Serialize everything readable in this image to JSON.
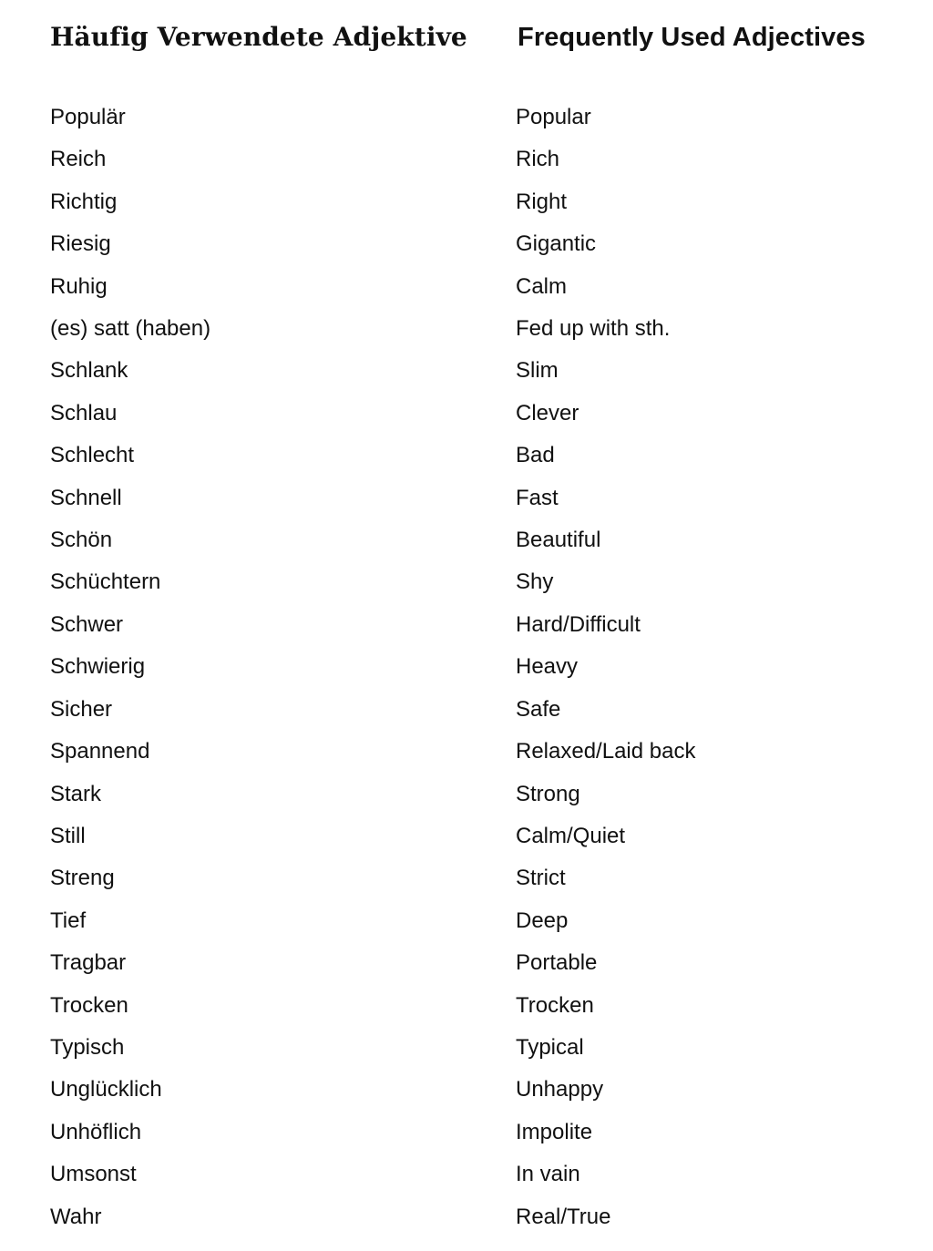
{
  "document": {
    "title": "Häufig Verwendete Adjektive / Frequently Used Adjectives",
    "background_color": "#ffffff",
    "text_color": "#111111"
  },
  "table": {
    "headers": {
      "source": "Häufig Verwendete Adjektive",
      "target": "Frequently Used Adjectives"
    },
    "rows": [
      {
        "source": "Populär",
        "target": "Popular"
      },
      {
        "source": "Reich",
        "target": "Rich"
      },
      {
        "source": "Richtig",
        "target": "Right"
      },
      {
        "source": "Riesig",
        "target": "Gigantic"
      },
      {
        "source": "Ruhig",
        "target": "Calm"
      },
      {
        "source": "(es) satt (haben)",
        "target": "Fed up with sth."
      },
      {
        "source": "Schlank",
        "target": "Slim"
      },
      {
        "source": "Schlau",
        "target": "Clever"
      },
      {
        "source": "Schlecht",
        "target": "Bad"
      },
      {
        "source": "Schnell",
        "target": "Fast"
      },
      {
        "source": "Schön",
        "target": "Beautiful"
      },
      {
        "source": "Schüchtern",
        "target": "Shy"
      },
      {
        "source": "Schwer",
        "target": "Hard/Difficult"
      },
      {
        "source": "Schwierig",
        "target": "Heavy"
      },
      {
        "source": "Sicher",
        "target": "Safe"
      },
      {
        "source": "Spannend",
        "target": "Relaxed/Laid back"
      },
      {
        "source": "Stark",
        "target": "Strong"
      },
      {
        "source": "Still",
        "target": "Calm/Quiet"
      },
      {
        "source": "Streng",
        "target": "Strict"
      },
      {
        "source": "Tief",
        "target": "Deep"
      },
      {
        "source": "Tragbar",
        "target": "Portable"
      },
      {
        "source": "Trocken",
        "target": "Trocken"
      },
      {
        "source": "Typisch",
        "target": "Typical"
      },
      {
        "source": "Unglücklich",
        "target": "Unhappy"
      },
      {
        "source": "Unhöflich",
        "target": "Impolite"
      },
      {
        "source": "Umsonst",
        "target": "In vain"
      },
      {
        "source": "Wahr",
        "target": "Real/True"
      }
    ]
  }
}
